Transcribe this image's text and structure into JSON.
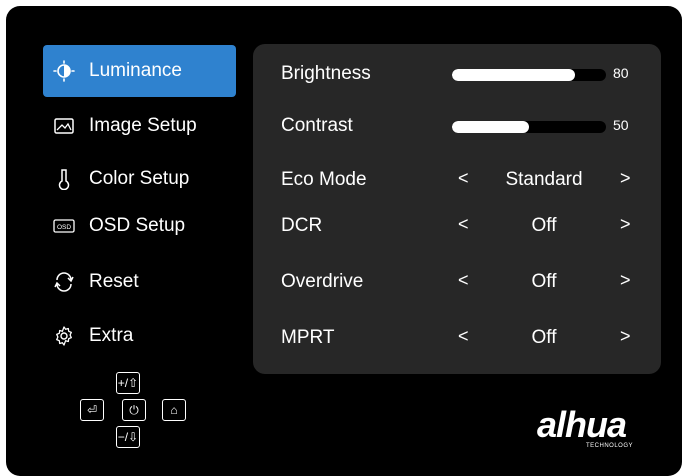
{
  "sidebar": {
    "items": [
      {
        "label": "Luminance",
        "icon": "luminance-icon",
        "active": true
      },
      {
        "label": "Image Setup",
        "icon": "image-setup-icon",
        "active": false
      },
      {
        "label": "Color Setup",
        "icon": "color-setup-icon",
        "active": false
      },
      {
        "label": "OSD Setup",
        "icon": "osd-setup-icon",
        "active": false
      },
      {
        "label": "Reset",
        "icon": "reset-icon",
        "active": false
      },
      {
        "label": "Extra",
        "icon": "gear-icon",
        "active": false
      }
    ],
    "osd_icon_text": "OSD"
  },
  "settings": {
    "brightness": {
      "label": "Brightness",
      "value": "80",
      "level": 80
    },
    "contrast": {
      "label": "Contrast",
      "value": "50",
      "level": 50
    },
    "eco_mode": {
      "label": "Eco Mode",
      "value": "Standard"
    },
    "dcr": {
      "label": "DCR",
      "value": "Off"
    },
    "overdrive": {
      "label": "Overdrive",
      "value": "Off"
    },
    "mprt": {
      "label": "MPRT",
      "value": "Off"
    }
  },
  "arrows": {
    "left": "<",
    "right": ">"
  },
  "keypad": {
    "plus": "+/⇧",
    "exit": "⏎",
    "power": "⏻",
    "home": "⌂",
    "minus": "−/⇩"
  },
  "brand": {
    "name": "alhua",
    "sub": "TECHNOLOGY"
  },
  "colors": {
    "accent": "#2f82cf",
    "panel": "#272727",
    "background": "#000000"
  }
}
